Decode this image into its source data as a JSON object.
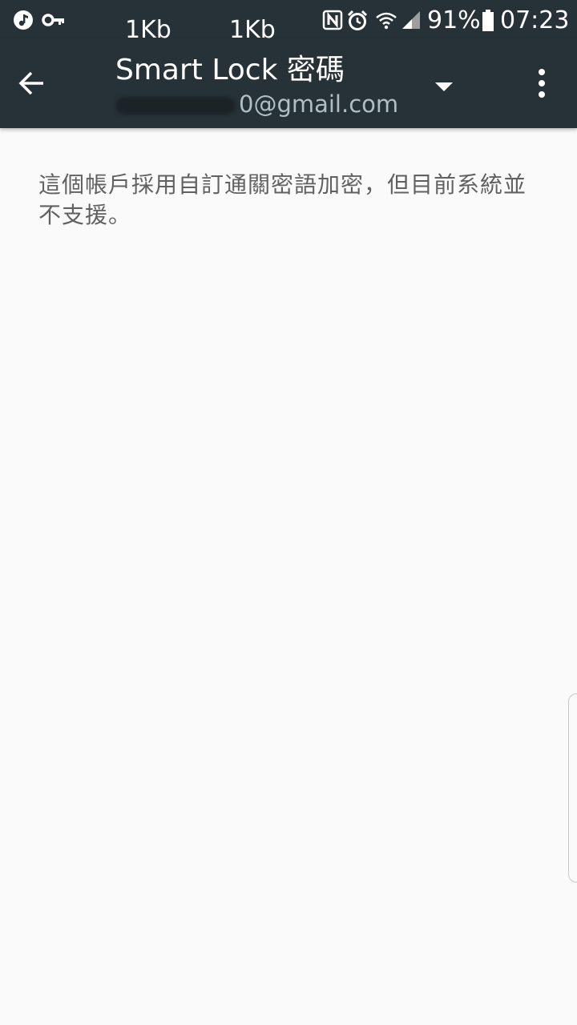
{
  "status_bar": {
    "icons_left": [
      "music-icon",
      "vpn-key-icon"
    ],
    "net_speed_1": "1Kb",
    "net_speed_2": "1Kb",
    "icons_right": [
      "nfc-icon",
      "alarm-icon",
      "wifi-icon",
      "cell-signal-icon"
    ],
    "battery_percent": "91%",
    "battery_icon": "battery-icon",
    "time": "07:23"
  },
  "app_bar": {
    "back_icon": "arrow-back-icon",
    "title": "Smart Lock 密碼",
    "account_visible_suffix": "0@gmail.com",
    "dropdown_icon": "dropdown-arrow-icon",
    "more_icon": "more-vert-icon",
    "background_color": "#263238"
  },
  "content": {
    "message": "這個帳戶採用自訂通關密語加密，但目前系統並不支援。",
    "background_color": "#fafafa",
    "text_color": "#616161"
  }
}
